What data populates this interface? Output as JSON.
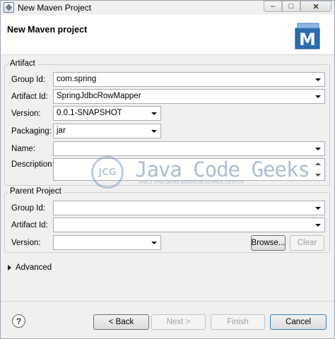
{
  "window": {
    "title": "New Maven Project",
    "icon": "maven-wizard-icon"
  },
  "caption_buttons": {
    "minimize": "–",
    "maximize": "□",
    "close": "✕"
  },
  "banner": {
    "title": "New Maven project",
    "logo_letter": "M"
  },
  "artifact": {
    "legend": "Artifact",
    "group_id": {
      "label": "Group Id:",
      "value": "com.spring"
    },
    "artifact_id": {
      "label": "Artifact Id:",
      "value": "SpringJdbcRowMapper"
    },
    "version": {
      "label": "Version:",
      "value": "0.0.1-SNAPSHOT"
    },
    "packaging": {
      "label": "Packaging:",
      "value": "jar"
    },
    "name": {
      "label": "Name:",
      "value": ""
    },
    "description": {
      "label": "Description:",
      "value": ""
    }
  },
  "parent": {
    "legend": "Parent Project",
    "group_id": {
      "label": "Group Id:",
      "value": ""
    },
    "artifact_id": {
      "label": "Artifact Id:",
      "value": ""
    },
    "version": {
      "label": "Version:",
      "value": ""
    },
    "browse_label": "Browse...",
    "clear_label": "Clear"
  },
  "advanced": {
    "label": "Advanced"
  },
  "footer": {
    "help_glyph": "?",
    "back_label": "Back",
    "next_label": "Next",
    "finish_label": "Finish",
    "cancel_label": "Cancel"
  },
  "watermark": {
    "logo_text": "JCG",
    "name": "Java Code Geeks",
    "tagline": "JAVA 2 JAVA DEVELOPERS RESOURCE CENTER"
  },
  "colors": {
    "window_bg": "#f0f0f0",
    "banner_bg": "#ffffff",
    "accent": "#3c7fb1",
    "maven_logo": "#2b6cb0"
  }
}
